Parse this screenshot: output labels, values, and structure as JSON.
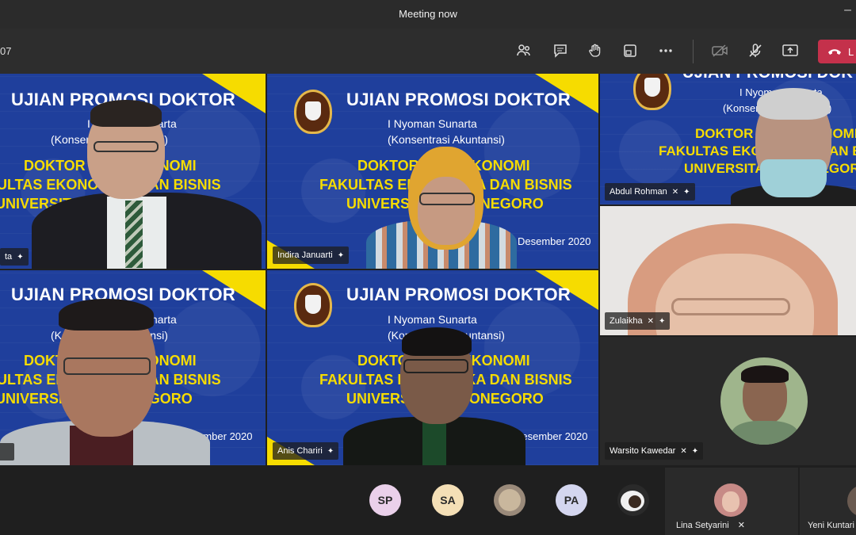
{
  "window": {
    "title": "Meeting now"
  },
  "toolbar": {
    "timer": "07",
    "leave_label": "L",
    "buttons": [
      "people-icon",
      "chat-icon",
      "raise-hand-icon",
      "share-tray-icon",
      "more-icon",
      "camera-off-icon",
      "mic-off-icon",
      "share-screen-icon"
    ]
  },
  "slide": {
    "title": "UJIAN PROMOSI DOKTOR",
    "name": "I Nyoman Sunarta",
    "concentration": "(Konsentrasi Akuntansi)",
    "line1": "DOKTOR ILMU EKONOMI",
    "line2": "FAKULTAS EKONOMIKA DAN BISNIS",
    "line3": "UNIVERSITAS DIPONEGORO",
    "date": "Desember 2020"
  },
  "participants": {
    "tile1_name": "ta",
    "tile2_name": "Indira Januarti",
    "tile3_name": "Abdul Rohman",
    "tile4_name": "Zulaikha",
    "tile5_name": "",
    "tile6_name": "Anis Chariri",
    "tile7_name": "Warsito Kawedar"
  },
  "bottom": {
    "avatars": [
      {
        "initials": "SP",
        "color": "#ead0ea"
      },
      {
        "initials": "SA",
        "color": "#f4dfb6"
      },
      {
        "initials": "PA",
        "color": "#d4d6ef"
      }
    ],
    "video1_name": "Lina Setyarini",
    "video2_name": "Yeni Kuntari"
  },
  "colors": {
    "slide_blue": "#1f3f9c",
    "accent_yellow": "#f6dc00",
    "leave_red": "#c4314b"
  }
}
